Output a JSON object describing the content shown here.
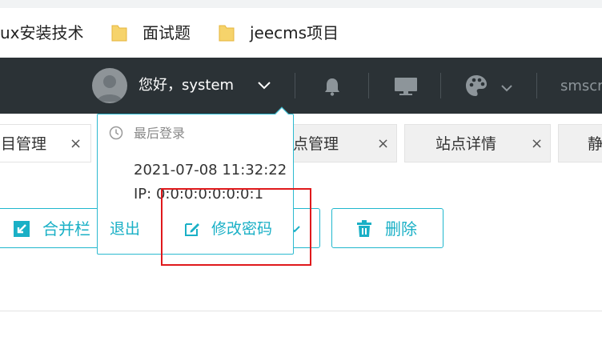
{
  "bookmarks": [
    {
      "label": "ux安装技术",
      "folder": false
    },
    {
      "label": "面试题",
      "folder": true
    },
    {
      "label": "jeecms项目",
      "folder": true
    }
  ],
  "header": {
    "greeting": "您好，system",
    "site_name": "smscr"
  },
  "tabs": [
    {
      "label": "目管理",
      "close": "×",
      "active": true
    },
    {
      "label": "站点管理",
      "close": "×",
      "active": false
    },
    {
      "label": "站点详情",
      "close": "×",
      "active": false
    },
    {
      "label": "静",
      "close": "",
      "active": false
    }
  ],
  "actions": {
    "merge_label": "合并栏",
    "delete_label": "删除"
  },
  "user_menu": {
    "last_login_label": "最后登录",
    "last_login_time": "2021-07-08 11:32:22",
    "ip": "IP: 0:0:0:0:0:0:0:1",
    "logout_label": "退出",
    "change_password_label": "修改密码"
  },
  "colors": {
    "header_bg": "#2b3236",
    "accent": "#1ab0c6",
    "highlight_box": "#e0191c"
  }
}
